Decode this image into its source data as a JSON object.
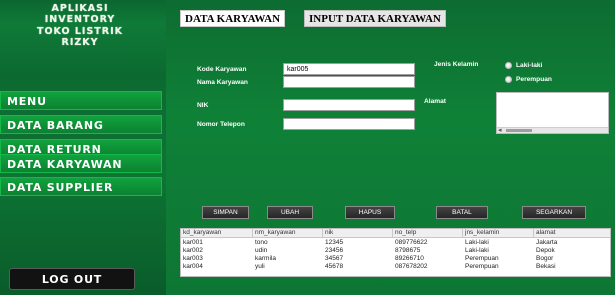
{
  "sidebar": {
    "app_title": "APLIKASI\nINVENTORY\nTOKO LISTRIK\nRIZKY",
    "menu_label": "MENU",
    "items": [
      {
        "label": "DATA BARANG"
      },
      {
        "label": "DATA RETURN"
      },
      {
        "label": "DATA KARYAWAN"
      },
      {
        "label": "DATA SUPPLIER"
      }
    ],
    "logout_label": "LOG OUT"
  },
  "tabs": [
    {
      "label": "DATA KARYAWAN"
    },
    {
      "label": "INPUT DATA KARYAWAN"
    }
  ],
  "form": {
    "kode_label": "Kode Karyawan",
    "kode_value": "kar005",
    "nama_label": "Nama Karyawan",
    "nama_value": "",
    "nik_label": "NIK",
    "nik_value": "",
    "telp_label": "Nomor Telepon",
    "telp_value": "",
    "gender_label": "Jenis Kelamin",
    "gender_options": [
      "Laki-laki",
      "Perempuan"
    ],
    "alamat_label": "Alamat"
  },
  "buttons": {
    "simpan": "SIMPAN",
    "ubah": "UBAH",
    "hapus": "HAPUS",
    "batal": "BATAL",
    "segarkan": "SEGARKAN"
  },
  "table": {
    "columns": [
      "kd_karyawan",
      "nm_karyawan",
      "nik",
      "no_telp",
      "jns_kelamin",
      "alamat"
    ],
    "rows": [
      [
        "kar001",
        "tono",
        "12345",
        "089776622",
        "Laki-laki",
        "Jakarta"
      ],
      [
        "kar002",
        "udin",
        "23456",
        "8798675",
        "Laki-laki",
        "Depok"
      ],
      [
        "kar003",
        "karmila",
        "34567",
        "89266710",
        "Perempuan",
        "Bogor"
      ],
      [
        "kar004",
        "yuli",
        "45678",
        "087678202",
        "Perempuan",
        "Bekasi"
      ]
    ]
  },
  "colors": {
    "sidebar_green": "#0d7434",
    "button_green": "#11a23e",
    "action_button": "#333333"
  }
}
